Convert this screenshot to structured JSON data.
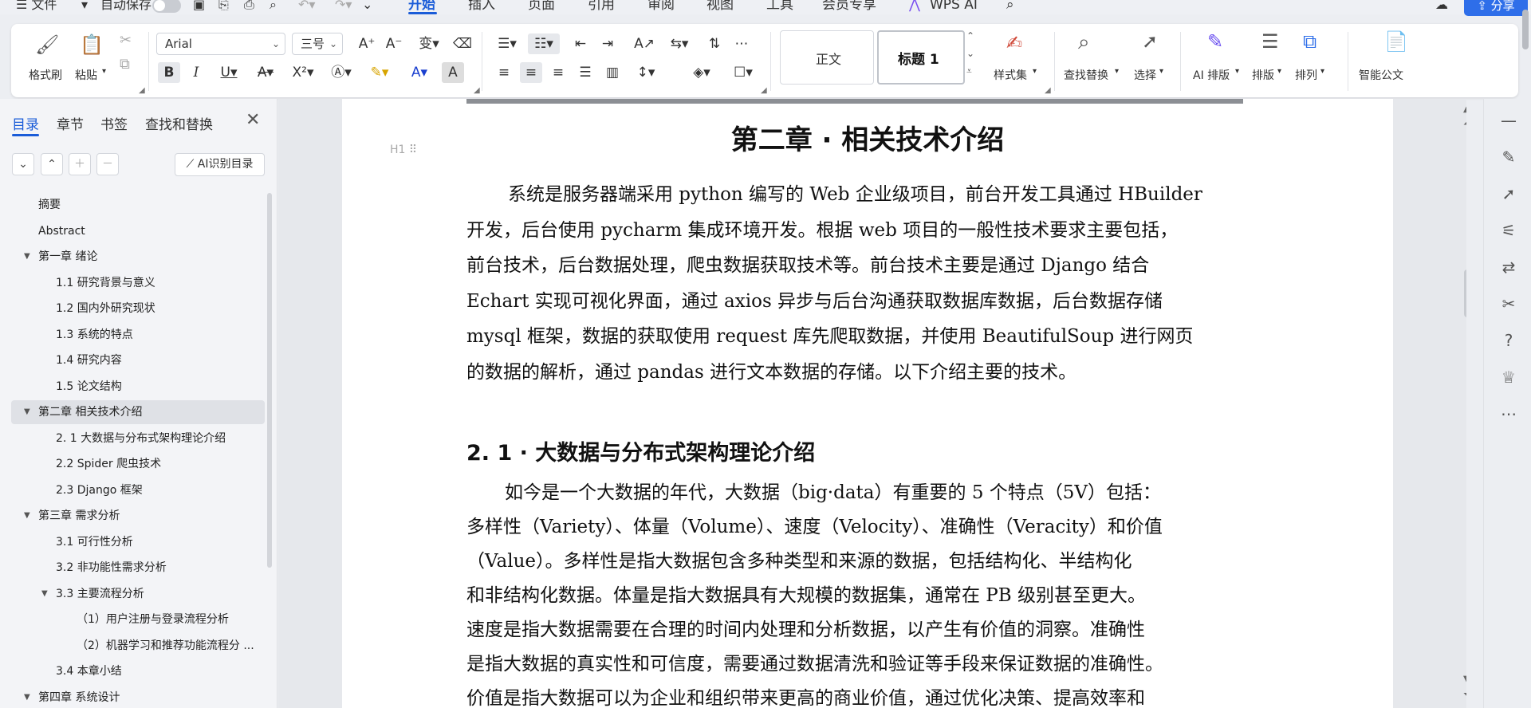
{
  "menubar": {
    "file": "☰ 文件",
    "autosave": "自动保存",
    "tabs": [
      "开始",
      "插入",
      "页面",
      "引用",
      "审阅",
      "视图",
      "工具",
      "会员专享"
    ],
    "wps_ai": "WPS AI",
    "share": "分享"
  },
  "ribbon": {
    "format_painter": "格式刷",
    "paste": "粘贴",
    "font_name": "Arial",
    "font_size": "三号",
    "style_normal": "正文",
    "style_heading1": "标题 1",
    "style_set": "样式集",
    "find_replace": "查找替换",
    "select": "选择",
    "ai_layout": "AI 排版",
    "layout": "排版",
    "arrange": "排列",
    "smart_doc": "智能公文"
  },
  "leftpanel": {
    "tabs": [
      "目录",
      "章节",
      "书签",
      "查找和替换"
    ],
    "ai_toc_button": "AI识别目录",
    "toc": [
      {
        "text": "摘要",
        "level": 1,
        "caret": ""
      },
      {
        "text": "Abstract",
        "level": 1,
        "caret": ""
      },
      {
        "text": "第一章  绪论",
        "level": 1,
        "caret": "▼"
      },
      {
        "text": "1.1 研究背景与意义",
        "level": 2,
        "caret": ""
      },
      {
        "text": "1.2 国内外研究现状",
        "level": 2,
        "caret": ""
      },
      {
        "text": "1.3 系统的特点",
        "level": 2,
        "caret": ""
      },
      {
        "text": "1.4 研究内容",
        "level": 2,
        "caret": ""
      },
      {
        "text": "1.5 论文结构",
        "level": 2,
        "caret": ""
      },
      {
        "text": "第二章  相关技术介绍",
        "level": 1,
        "caret": "▼",
        "selected": true
      },
      {
        "text": "2. 1  大数据与分布式架构理论介绍",
        "level": 2,
        "caret": ""
      },
      {
        "text": "2.2 Spider 爬虫技术",
        "level": 2,
        "caret": ""
      },
      {
        "text": "2.3 Django 框架",
        "level": 2,
        "caret": ""
      },
      {
        "text": "第三章  需求分析",
        "level": 1,
        "caret": "▼"
      },
      {
        "text": "3.1 可行性分析",
        "level": 2,
        "caret": ""
      },
      {
        "text": "3.2 非功能性需求分析",
        "level": 2,
        "caret": ""
      },
      {
        "text": "3.3 主要流程分析",
        "level": 2,
        "caret": "▼"
      },
      {
        "text": "（1）用户注册与登录流程分析",
        "level": 3,
        "caret": ""
      },
      {
        "text": "（2）机器学习和推荐功能流程分 ...",
        "level": 3,
        "caret": ""
      },
      {
        "text": "3.4 本章小结",
        "level": 2,
        "caret": ""
      },
      {
        "text": "第四章  系统设计",
        "level": 1,
        "caret": "▼"
      }
    ]
  },
  "document": {
    "chapter_title": "第二章 · 相关技术介绍",
    "heading_marker": "H1",
    "paragraph1": [
      "系统是服务器端采用 python 编写的 Web 企业级项目，前台开发工具通过 HBuilder",
      "开发，后台使用 pycharm 集成环境开发。根据 web 项目的一般性技术要求主要包括，",
      "前台技术，后台数据处理，爬虫数据获取技术等。前台技术主要是通过 Django 结合",
      "Echart 实现可视化界面，通过 axios 异步与后台沟通获取数据库数据，后台数据存储",
      "mysql 框架，数据的获取使用 request 库先爬取数据，并使用 BeautifulSoup 进行网页",
      "的数据的解析，通过 pandas 进行文本数据的存储。以下介绍主要的技术。"
    ],
    "section_title": "2. 1 · 大数据与分布式架构理论介绍",
    "paragraph2": [
      "如今是一个大数据的年代，大数据（big·data）有重要的 5 个特点（5V）包括：",
      "多样性（Variety）、体量（Volume）、速度（Velocity）、准确性（Veracity）和价值",
      "（Value）。多样性是指大数据包含多种类型和来源的数据，包括结构化、半结构化",
      "和非结构化数据。体量是指大数据具有大规模的数据集，通常在 PB 级别甚至更大。",
      "速度是指大数据需要在合理的时间内处理和分析数据，以产生有价值的洞察。准确性",
      "是指大数据的真实性和可信度，需要通过数据清洗和验证等手段来保证数据的准确性。",
      "价值是指大数据可以为企业和组织带来更高的商业价值，通过优化决策、提高效率和"
    ]
  },
  "colors": {
    "accent": "#1a5cd8",
    "share": "#2e6ee9"
  }
}
